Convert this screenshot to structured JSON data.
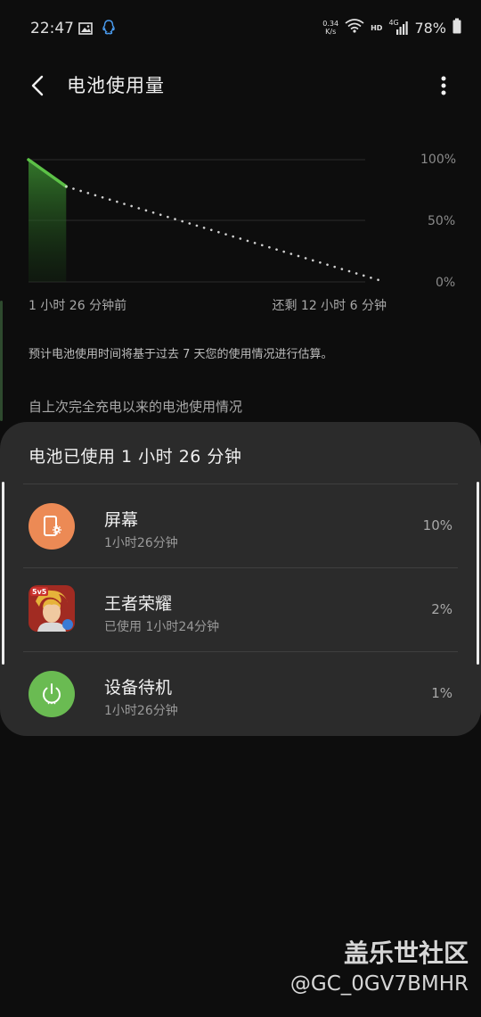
{
  "status_bar": {
    "time": "22:47",
    "net_speed_value": "0.34",
    "net_speed_unit": "K/s",
    "network_label": "HD",
    "network_type": "4G",
    "battery_percent": "78%"
  },
  "header": {
    "title": "电池使用量",
    "back_icon": "back-arrow-icon",
    "more_icon": "more-vertical-icon"
  },
  "chart": {
    "y_ticks": [
      "100%",
      "50%",
      "0%"
    ],
    "x_start_label": "1 小时 26 分钟前",
    "x_end_label": "还剩 12 小时 6 分钟",
    "accent_color": "#5cc147",
    "projection_color": "#cfcfcf"
  },
  "chart_data": {
    "type": "line",
    "ylim": [
      0,
      100
    ],
    "y_ticks": [
      "100%",
      "50%",
      "0%"
    ],
    "x_labels": [
      "1 小时 26 分钟前",
      "还剩 12 小时 6 分钟"
    ],
    "series": [
      {
        "values": [
          [
            0,
            100
          ],
          [
            1.43,
            78
          ]
        ],
        "style": "solid"
      },
      {
        "values": [
          [
            1.43,
            78
          ],
          [
            13.53,
            0
          ]
        ],
        "style": "dotted"
      }
    ]
  },
  "note": "预计电池使用时间将基于过去 7 天您的使用情况进行估算。",
  "section_title": "自上次完全充电以来的电池使用情况",
  "usage_card": {
    "title": "电池已使用 1 小时 26 分钟",
    "items": [
      {
        "name": "屏幕",
        "detail": "1小时26分钟",
        "percent": "10%",
        "icon": "screen-settings-icon",
        "color": "#ec8a55"
      },
      {
        "name": "王者荣耀",
        "detail": "已使用 1小时24分钟",
        "percent": "2%",
        "icon": "game-app-icon",
        "color": "#c8382c"
      },
      {
        "name": "设备待机",
        "detail": "1小时26分钟",
        "percent": "1%",
        "icon": "power-icon",
        "color": "#6abb52"
      }
    ]
  },
  "watermark": {
    "title": "盖乐世社区",
    "handle": "@GC_0GV7BMHR"
  }
}
